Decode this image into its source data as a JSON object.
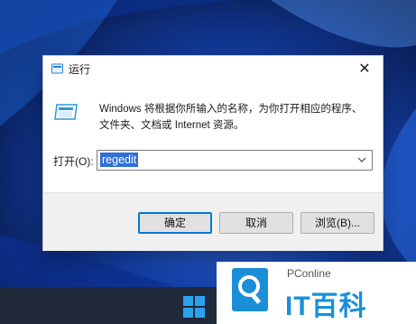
{
  "dialog": {
    "title": "运行",
    "close_glyph": "✕",
    "description_line1": "Windows 将根据你所输入的名称，为你打开相应的程序、",
    "description_line2": "文件夹、文档或 Internet 资源。",
    "open_label": "打开(O):",
    "input_value": "regedit",
    "buttons": {
      "ok": "确定",
      "cancel": "取消",
      "browse": "浏览(B)..."
    },
    "icons": {
      "title": "run-icon",
      "body": "run-icon",
      "dropdown": "chevron-down-icon",
      "close": "close-icon"
    }
  },
  "taskbar": {
    "start_icon": "windows-logo-icon",
    "accent": "#2aa2f0"
  },
  "watermark": {
    "brand": "PConline",
    "brand_large": "IT百科",
    "accent": "#1a8fd8"
  }
}
